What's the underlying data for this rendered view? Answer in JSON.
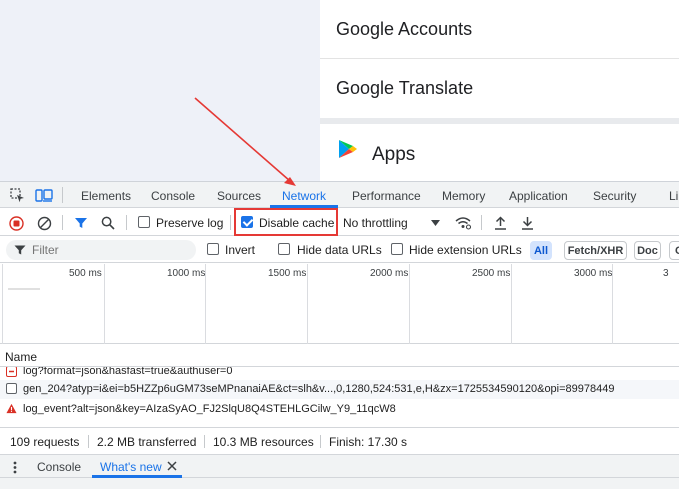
{
  "webpage": {
    "google_menu": {
      "items": [
        "Google Accounts",
        "Google Translate"
      ],
      "apps_label": "Apps"
    }
  },
  "devtools": {
    "tabs": [
      "Elements",
      "Console",
      "Sources",
      "Network",
      "Performance",
      "Memory",
      "Application",
      "Security",
      "Li"
    ],
    "active_tab": "Network",
    "toolbar": {
      "preserve_log_label": "Preserve log",
      "preserve_log_checked": false,
      "disable_cache_label": "Disable cache",
      "disable_cache_checked": true,
      "throttling_value": "No throttling"
    },
    "filter": {
      "placeholder": "Filter",
      "invert_label": "Invert",
      "hide_data_urls_label": "Hide data URLs",
      "hide_extension_urls_label": "Hide extension URLs",
      "type_chips": [
        "All",
        "Fetch/XHR",
        "Doc",
        "C"
      ],
      "active_chip": "All"
    },
    "overview": {
      "ticks": [
        "500 ms",
        "1000 ms",
        "1500 ms",
        "2000 ms",
        "2500 ms",
        "3000 ms",
        "3"
      ]
    },
    "requests": {
      "column_header": "Name",
      "rows": [
        {
          "name": "log?format=json&hasfast=true&authuser=0",
          "status": "error"
        },
        {
          "name": "gen_204?atyp=i&ei=b5HZZp6uGM73seMPnanaiAE&ct=slh&v...,0,1280,524:531,e,H&zx=1725534590120&opi=89978449",
          "status": "ok"
        },
        {
          "name": "log_event?alt=json&key=AIzaSyAO_FJ2SlqU8Q4STEHLGCilw_Y9_11qcW8",
          "status": "warning"
        }
      ]
    },
    "status": {
      "requests": "109 requests",
      "transferred": "2.2 MB transferred",
      "resources": "10.3 MB resources",
      "finish": "Finish: 17.30 s"
    },
    "drawer": {
      "tabs": [
        "Console",
        "What's new"
      ],
      "active_tab": "What's new"
    }
  },
  "colors": {
    "accent": "#1a73e8",
    "record_red": "#d93025",
    "annotation_red": "#e53935",
    "warning": "#e37400"
  }
}
